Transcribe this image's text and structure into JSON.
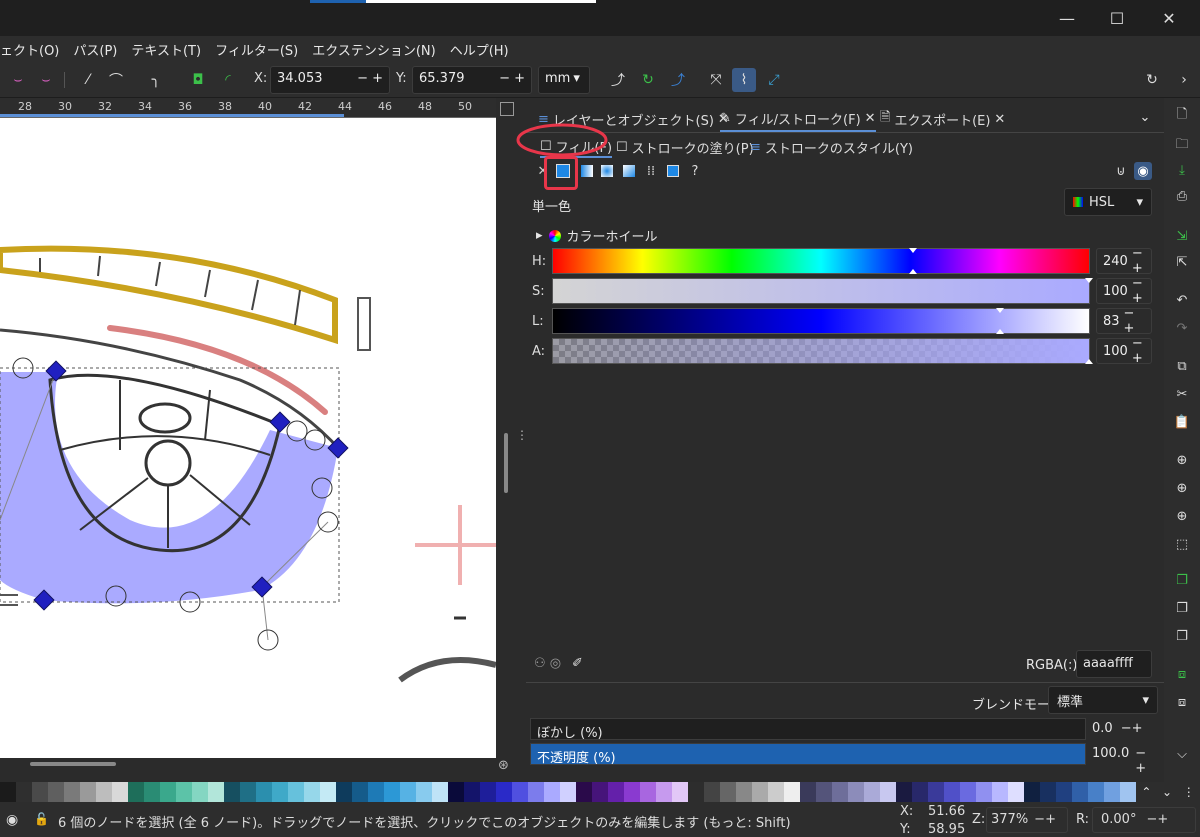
{
  "menu": [
    "ェクト(O)",
    "パス(P)",
    "テキスト(T)",
    "フィルター(S)",
    "エクステンション(N)",
    "ヘルプ(H)"
  ],
  "toolbar": {
    "x_label": "X:",
    "x_value": "34.053",
    "y_label": "Y:",
    "y_value": "65.379",
    "unit": "mm"
  },
  "ruler_ticks": [
    "28",
    "30",
    "32",
    "34",
    "36",
    "38",
    "40",
    "42",
    "44",
    "46",
    "48",
    "50"
  ],
  "panel": {
    "tabs": [
      {
        "label": "レイヤーとオブジェクト(S)"
      },
      {
        "label": "フィル/ストローク(F)"
      },
      {
        "label": "エクスポート(E)"
      }
    ],
    "subtabs": [
      {
        "label": "フィル(F)"
      },
      {
        "label": "ストロークの塗り(P)"
      },
      {
        "label": "ストロークのスタイル(Y)"
      }
    ],
    "flat_color_label": "単一色",
    "color_mode": "HSL",
    "color_wheel_label": "カラーホイール",
    "sliders": [
      {
        "label": "H:",
        "value": "240",
        "marker_pct": 66
      },
      {
        "label": "S:",
        "value": "100",
        "marker_pct": 100
      },
      {
        "label": "L:",
        "value": "83",
        "marker_pct": 83
      },
      {
        "label": "A:",
        "value": "100",
        "marker_pct": 100
      }
    ],
    "rgba_label": "RGBA(:):",
    "rgba_value": "aaaaffff",
    "blend_label": "ブレンドモード:",
    "blend_value": "標準",
    "blur_label": "ぼかし (%)",
    "blur_value": "0.0",
    "opacity_label": "不透明度 (%)",
    "opacity_value": "100.0"
  },
  "status": {
    "message": "6 個のノードを選択 (全 6 ノード)。ドラッグでノードを選択、クリックでこのオブジェクトのみを編集します (もっと: Shift)",
    "x_label": "X:",
    "x_value": "51.66",
    "y_label": "Y:",
    "y_value": "58.95",
    "zoom_label": "Z:",
    "zoom_value": "377%",
    "rotate_label": "R:",
    "rotate_value": "0.00°"
  },
  "colors": {
    "fill": "#aaaaff",
    "accent": "#1e62b0",
    "highlight_red": "#e8364a"
  }
}
